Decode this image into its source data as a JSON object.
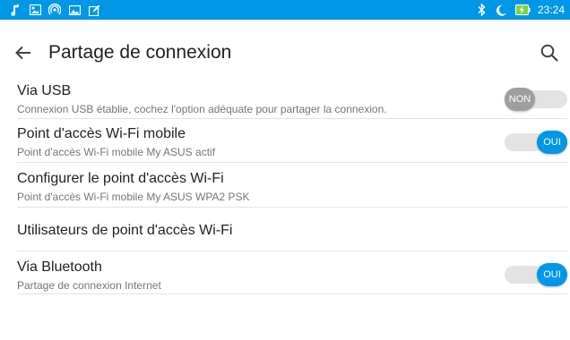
{
  "colors": {
    "accent": "#0097e6",
    "status_bar": "#0097e6",
    "toggle_off": "#9e9e9e"
  },
  "status_bar": {
    "left_icons": [
      "music-note-icon",
      "image-icon",
      "hotspot-icon",
      "photo-icon",
      "edit-icon"
    ],
    "right_icons": [
      "bluetooth-icon",
      "do-not-disturb-moon-icon",
      "battery-charging-icon"
    ],
    "time": "23:24"
  },
  "toolbar": {
    "title": "Partage de connexion",
    "back_icon": "arrow-back-icon",
    "search_icon": "search-icon"
  },
  "settings": [
    {
      "label": "Via USB",
      "subtitle": "Connexion USB établie, cochez l'option adéquate pour partager la connexion.",
      "toggle": "NON",
      "toggle_on": false
    },
    {
      "label": "Point d'accès Wi-Fi mobile",
      "subtitle": "Point d'accès Wi-Fi mobile My ASUS actif",
      "toggle": "OUI",
      "toggle_on": true
    },
    {
      "label": "Configurer le point d'accès Wi-Fi",
      "subtitle": "Point d'accès Wi-Fi mobile My ASUS WPA2 PSK"
    },
    {
      "label": "Utilisateurs de point d'accès Wi-Fi"
    },
    {
      "label": "Via Bluetooth",
      "subtitle": "Partage de connexion Internet",
      "toggle": "OUI",
      "toggle_on": true
    }
  ]
}
